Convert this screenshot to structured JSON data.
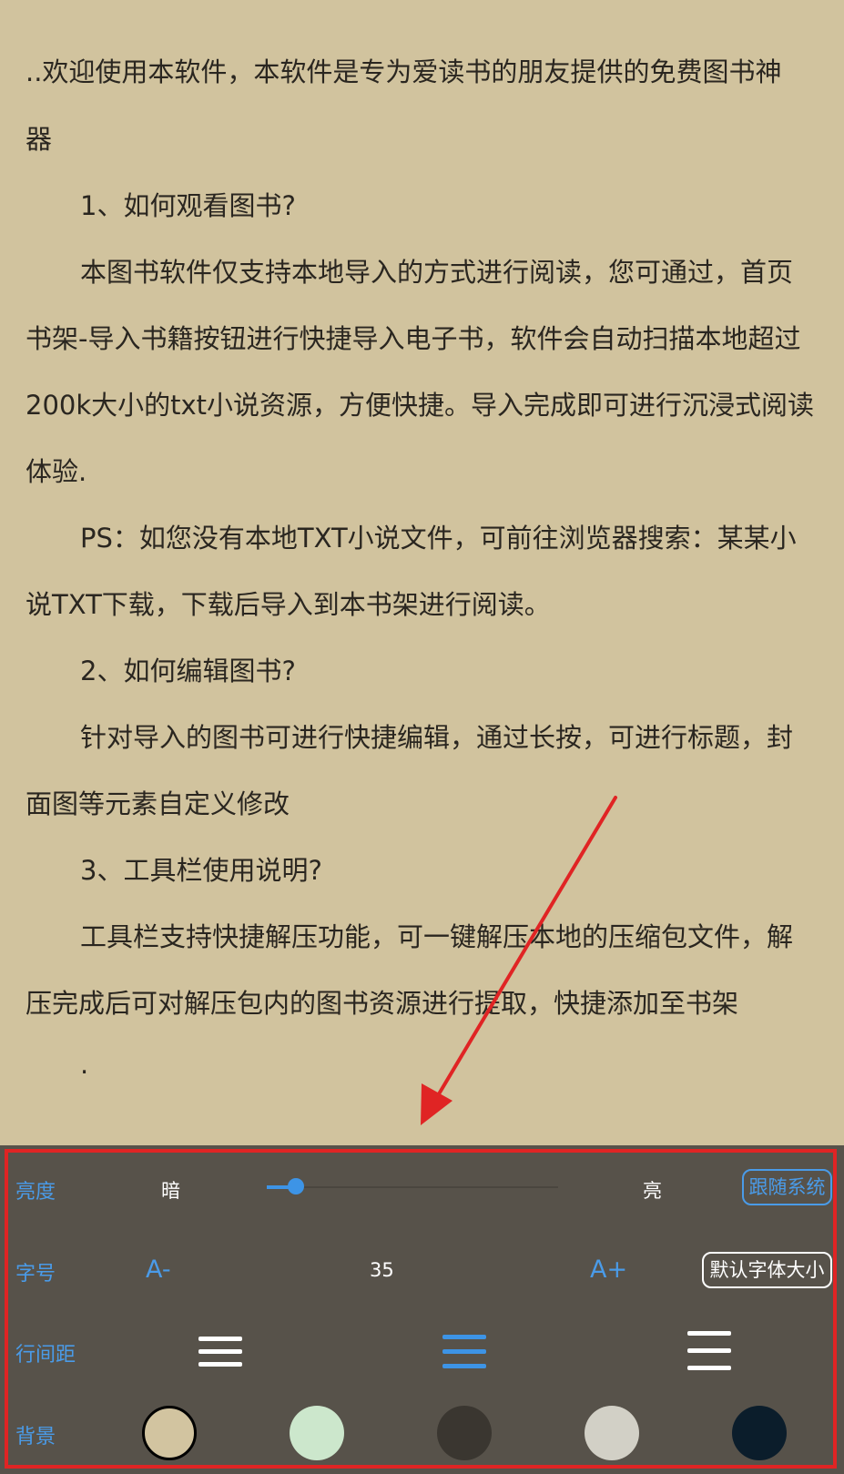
{
  "reader": {
    "paragraphs": [
      "..欢迎使用本软件，本软件是专为爱读书的朋友提供的免费图书神",
      "器",
      "1、如何观看图书?",
      "本图书软件仅支持本地导入的方式进行阅读，您可通过，首页",
      "书架-导入书籍按钮进行快捷导入电子书，软件会自动扫描本地超过",
      "200k大小的txt小说资源，方便快捷。导入完成即可进行沉浸式阅读",
      "体验.",
      "PS：如您没有本地TXT小说文件，可前往浏览器搜索：某某小",
      "说TXT下载，下载后导入到本书架进行阅读。",
      "2、如何编辑图书?",
      "针对导入的图书可进行快捷编辑，通过长按，可进行标题，封",
      "面图等元素自定义修改",
      "3、工具栏使用说明?",
      "工具栏支持快捷解压功能，可一键解压本地的压缩包文件，解",
      "压完成后可对解压包内的图书资源进行提取，快捷添加至书架",
      "."
    ]
  },
  "settings": {
    "brightness": {
      "label": "亮度",
      "dark": "暗",
      "bright": "亮",
      "level": 0.1,
      "follow_system": "跟随系统"
    },
    "font": {
      "label": "字号",
      "decrease": "A-",
      "size": "35",
      "increase": "A+",
      "default": "默认字体大小"
    },
    "line_spacing": {
      "label": "行间距",
      "options": [
        "compact",
        "medium",
        "loose"
      ],
      "selected": 1
    },
    "background": {
      "label": "背景",
      "colors": [
        "#d2c4a0",
        "#cce7cc",
        "#3a3630",
        "#d2d0c6",
        "#0b1d2b"
      ],
      "selected": 0
    }
  },
  "colors": {
    "accent": "#3d94e6",
    "annotation": "#e02424",
    "panel": "#57524a",
    "page": "#d1c39e"
  }
}
